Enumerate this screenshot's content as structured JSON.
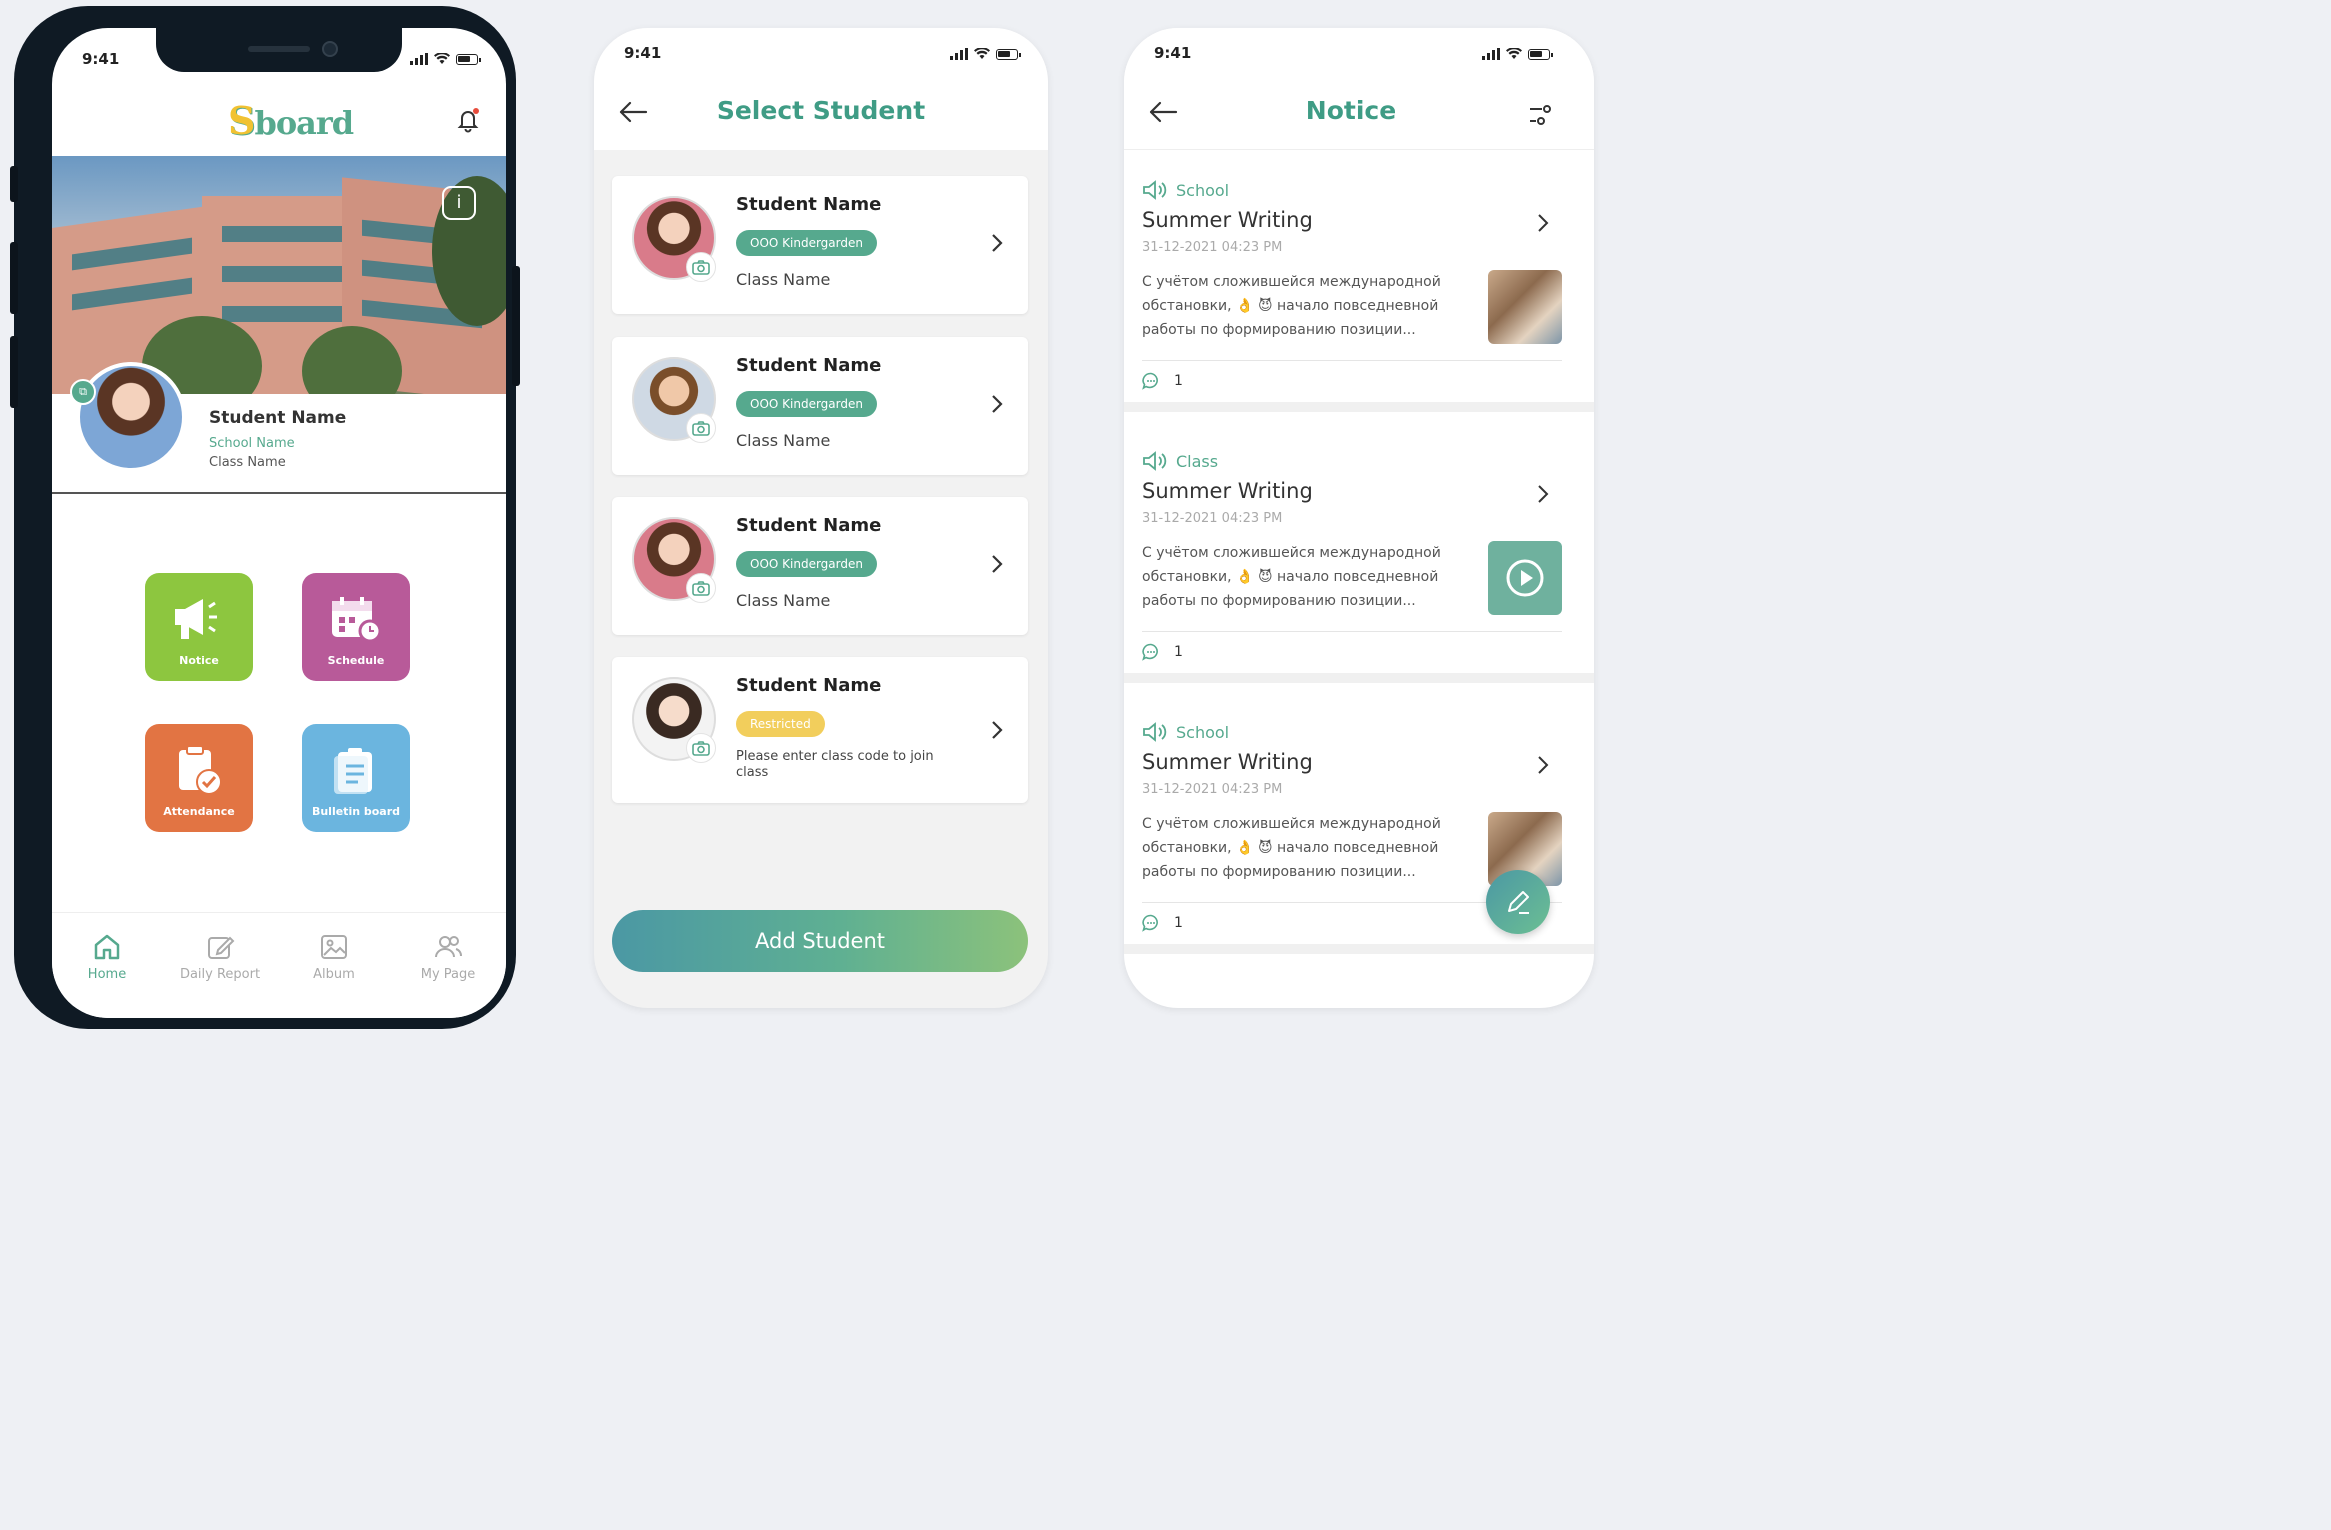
{
  "status_time": "9:41",
  "home": {
    "logo": {
      "first": "S",
      "rest": "board"
    },
    "profile": {
      "name": "Student Name",
      "school": "School Name",
      "class": "Class Name"
    },
    "tiles": [
      {
        "label": "Notice",
        "color": "#8dc63f"
      },
      {
        "label": "Schedule",
        "color": "#b85a99"
      },
      {
        "label": "Attendance",
        "color": "#e27443"
      },
      {
        "label": "Bulletin board",
        "color": "#6bb5df"
      }
    ],
    "tabs": [
      {
        "label": "Home",
        "active": true
      },
      {
        "label": "Daily Report",
        "active": false
      },
      {
        "label": "Album",
        "active": false
      },
      {
        "label": "My Page",
        "active": false
      }
    ]
  },
  "select_student": {
    "title": "Select Student",
    "students": [
      {
        "name": "Student Name",
        "badge": "OOO Kindergarden",
        "badge_color": "#56a98e",
        "subtitle": "Class Name"
      },
      {
        "name": "Student Name",
        "badge": "OOO Kindergarden",
        "badge_color": "#56a98e",
        "subtitle": "Class Name"
      },
      {
        "name": "Student Name",
        "badge": "OOO Kindergarden",
        "badge_color": "#56a98e",
        "subtitle": "Class Name"
      },
      {
        "name": "Student Name",
        "badge": "Restricted",
        "badge_color": "#f2ce5c",
        "subtitle": "Please enter class code to join class"
      }
    ],
    "add_button": "Add Student"
  },
  "notice": {
    "title": "Notice",
    "items": [
      {
        "category": "School",
        "title": "Summer Writing",
        "date": "31-12-2021  04:23 PM",
        "body": "С учётом сложившейся международной обстановки, 👌 😈 начало повседневной работы по формированию позиции...",
        "comments": "1",
        "media": "photo"
      },
      {
        "category": "Class",
        "title": "Summer Writing",
        "date": "31-12-2021  04:23 PM",
        "body": "С учётом сложившейся международной обстановки, 👌 😈 начало повседневной работы по формированию позиции...",
        "comments": "1",
        "media": "video"
      },
      {
        "category": "School",
        "title": "Summer Writing",
        "date": "31-12-2021  04:23 PM",
        "body": "С учётом сложившейся международной обстановки, 👌 😈 начало повседневной работы по формированию позиции...",
        "comments": "1",
        "media": "photo"
      }
    ]
  },
  "colors": {
    "accent": "#56a98e",
    "title": "#3f9c85"
  }
}
